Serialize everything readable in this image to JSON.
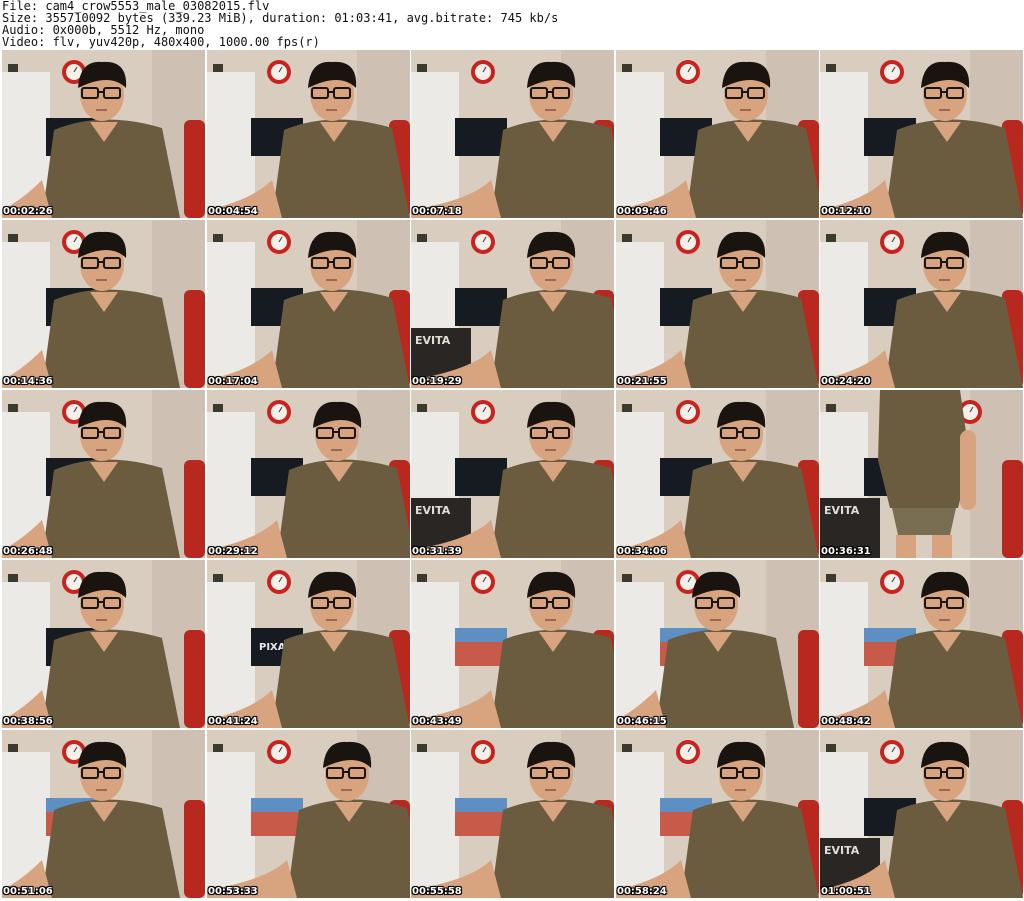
{
  "header": {
    "file_line": "File: cam4_crow5553_male_03082015.flv",
    "size_line": "Size: 355710092 bytes (339.23 MiB), duration: 01:03:41, avg.bitrate: 745 kb/s",
    "audio_line": "Audio: 0x000b, 5512 Hz, mono",
    "video_line": "Video: flv, yuv420p, 480x400, 1000.00 fps(r)"
  },
  "grid": {
    "columns": 5,
    "rows": 5
  },
  "thumbnails": [
    {
      "timestamp": "00:02:26",
      "variant": "a",
      "tv": "dark"
    },
    {
      "timestamp": "00:04:54",
      "variant": "b",
      "tv": "dark"
    },
    {
      "timestamp": "00:07:18",
      "variant": "c",
      "tv": "dark"
    },
    {
      "timestamp": "00:09:46",
      "variant": "d",
      "tv": "dark"
    },
    {
      "timestamp": "00:12:10",
      "variant": "b",
      "tv": "dark"
    },
    {
      "timestamp": "00:14:36",
      "variant": "a",
      "tv": "dark"
    },
    {
      "timestamp": "00:17:04",
      "variant": "b",
      "tv": "dark"
    },
    {
      "timestamp": "00:19:29",
      "variant": "c",
      "tv": "poster"
    },
    {
      "timestamp": "00:21:55",
      "variant": "b",
      "tv": "dark"
    },
    {
      "timestamp": "00:24:20",
      "variant": "b",
      "tv": "dark"
    },
    {
      "timestamp": "00:26:48",
      "variant": "a",
      "tv": "dark"
    },
    {
      "timestamp": "00:29:12",
      "variant": "d",
      "tv": "dark"
    },
    {
      "timestamp": "00:31:39",
      "variant": "c",
      "tv": "poster"
    },
    {
      "timestamp": "00:34:06",
      "variant": "b",
      "tv": "dark"
    },
    {
      "timestamp": "00:36:31",
      "variant": "standing",
      "tv": "poster"
    },
    {
      "timestamp": "00:38:56",
      "variant": "a",
      "tv": "dark"
    },
    {
      "timestamp": "00:41:24",
      "variant": "b",
      "tv": "pixar"
    },
    {
      "timestamp": "00:43:49",
      "variant": "c",
      "tv": "bright"
    },
    {
      "timestamp": "00:46:15",
      "variant": "a",
      "tv": "bright"
    },
    {
      "timestamp": "00:48:42",
      "variant": "b",
      "tv": "bright"
    },
    {
      "timestamp": "00:51:06",
      "variant": "a",
      "tv": "bright"
    },
    {
      "timestamp": "00:53:33",
      "variant": "c",
      "tv": "bright"
    },
    {
      "timestamp": "00:55:58",
      "variant": "c",
      "tv": "bright"
    },
    {
      "timestamp": "00:58:24",
      "variant": "b",
      "tv": "bright"
    },
    {
      "timestamp": "01:00:51",
      "variant": "b",
      "tv": "poster"
    }
  ],
  "tv_overlay": {
    "pixar_text": "PIXAR",
    "poster_text": "EVITA"
  },
  "colors": {
    "wall": "#d9cdbf",
    "wall_shadow": "#b9ad9f",
    "white_panel": "#eceae6",
    "clock_red": "#c8231f",
    "chair_red": "#b8281f",
    "shirt": "#6b5c3f",
    "shirt_dark": "#54482f",
    "skin": "#d7a47f",
    "hair": "#1a1410",
    "glasses": "#151515",
    "tv_dark": "#151b20",
    "tv_bright": "#c85a4a",
    "tv_bright_top": "#5e8fc2",
    "timestamp_text": "#ffffff"
  }
}
